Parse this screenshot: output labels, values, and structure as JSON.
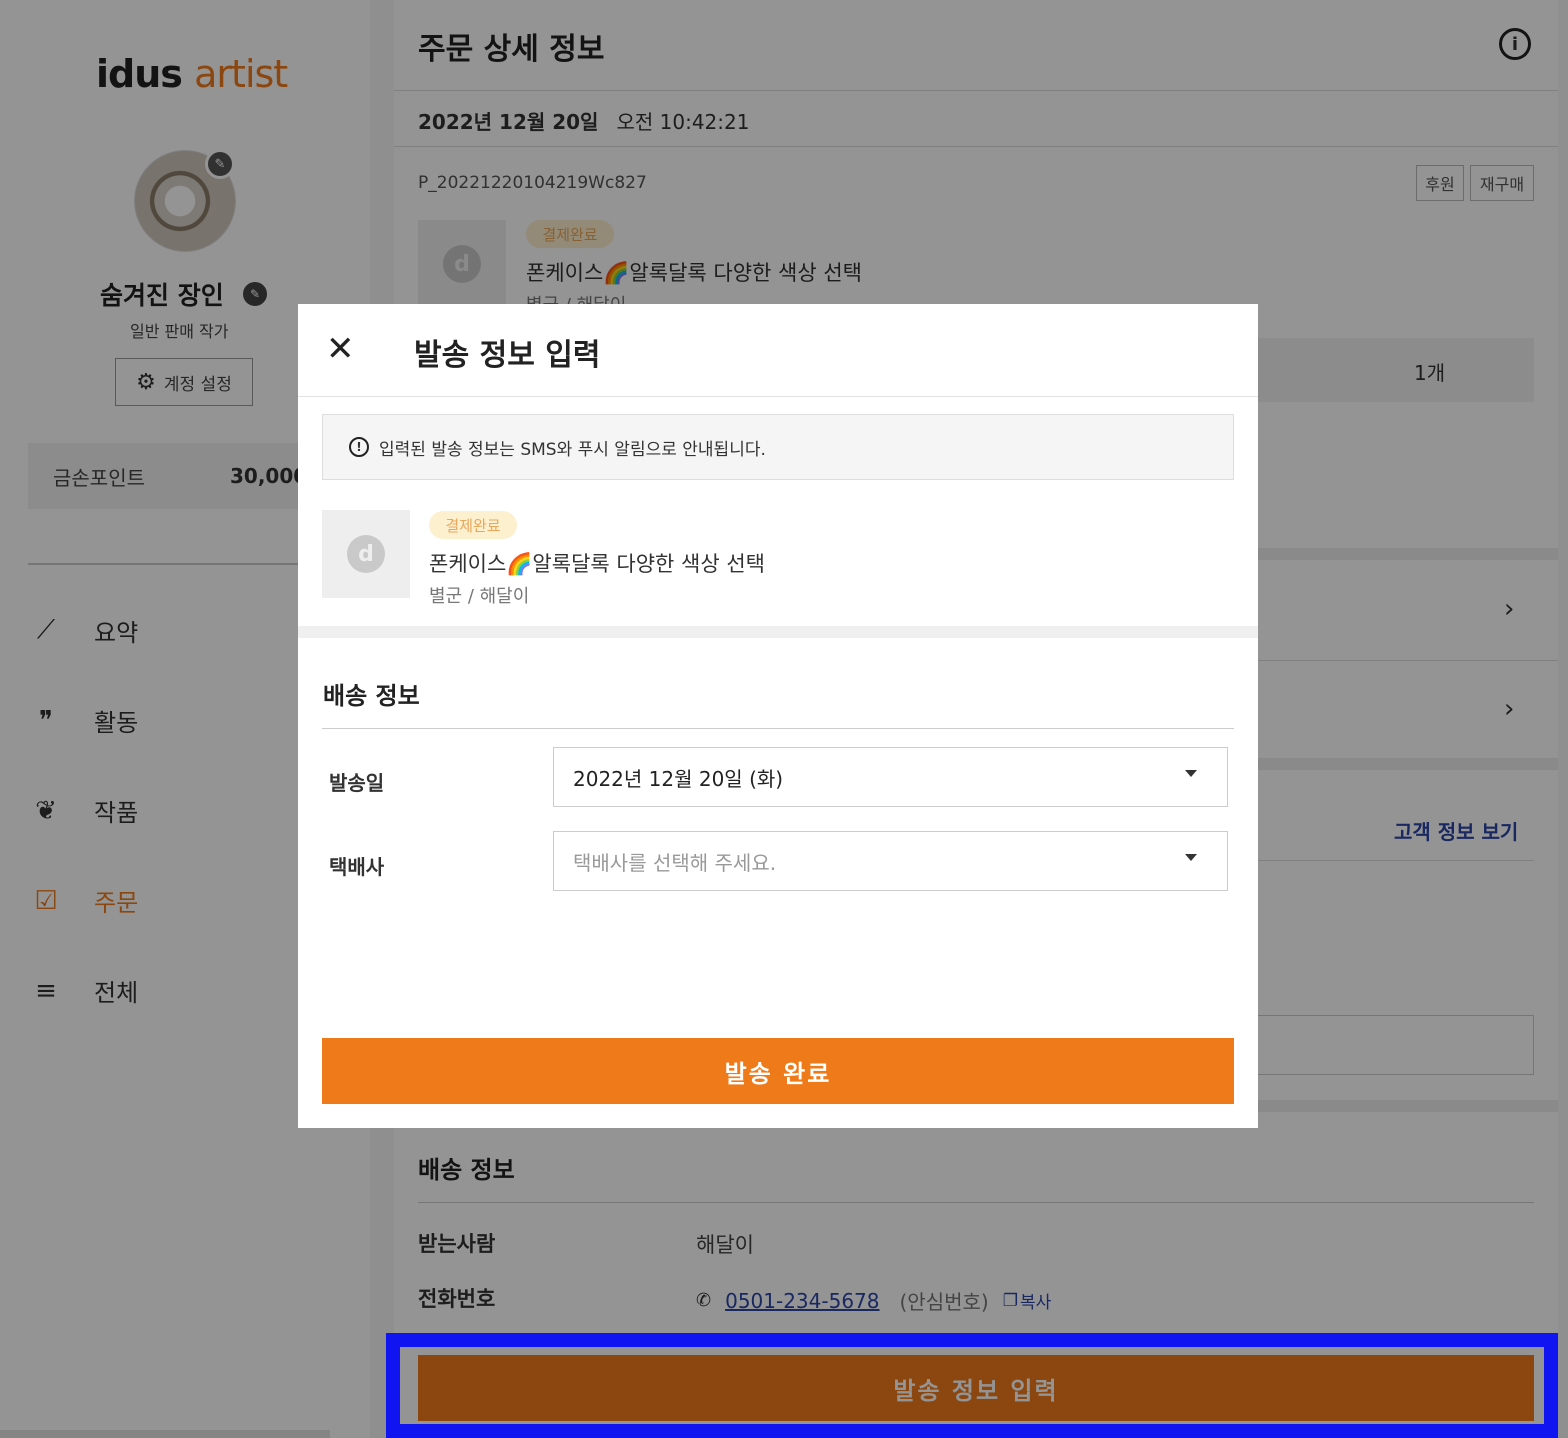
{
  "sidebar": {
    "logo_part1": "idus",
    "logo_part2": "artist",
    "artist_name": "숨겨진 장인",
    "artist_role": "일반 판매 작가",
    "account_button": "계정 설정",
    "points_label": "금손포인트",
    "points_value": "30,000",
    "nav": [
      {
        "label": "요약",
        "icon": "trending-up-icon"
      },
      {
        "label": "활동",
        "icon": "quote-icon"
      },
      {
        "label": "작품",
        "icon": "plant-icon"
      },
      {
        "label": "주문",
        "icon": "order-list-icon",
        "active": true
      },
      {
        "label": "전체",
        "icon": "menu-icon"
      }
    ]
  },
  "main": {
    "title": "주문 상세 정보",
    "date": "2022년 12월 20일",
    "time": "오전 10:42:21",
    "order_number": "P_20221220104219Wc827",
    "tags": [
      "후원",
      "재구매"
    ],
    "product": {
      "status": "결제완료",
      "name": "폰케이스🌈알록달록 다양한 색상 선택",
      "option": "별군 / 해달이"
    },
    "quantity": "1개",
    "customer_link": "고객 정보 보기",
    "shipping": {
      "title": "배송 정보",
      "recipient_label": "받는사람",
      "recipient_value": "해달이",
      "phone_label": "전화번호",
      "phone_value": "0501-234-5678",
      "phone_note": "(안심번호)",
      "copy_label": "복사"
    },
    "bottom_button": "발송 정보 입력"
  },
  "modal": {
    "title": "발송 정보 입력",
    "notice": "입력된 발송 정보는 SMS와 푸시 알림으로 안내됩니다.",
    "product": {
      "status": "결제완료",
      "name": "폰케이스🌈알록달록 다양한 색상 선택",
      "option": "별군 / 해달이"
    },
    "section_title": "배송 정보",
    "ship_date_label": "발송일",
    "ship_date_value": "2022년 12월 20일 (화)",
    "courier_label": "택배사",
    "courier_placeholder": "택배사를 선택해 주세요.",
    "submit_label": "발송 완료"
  },
  "colors": {
    "accent": "#ef7a1a",
    "link": "#2b45a8",
    "highlight": "#0f14f0"
  }
}
